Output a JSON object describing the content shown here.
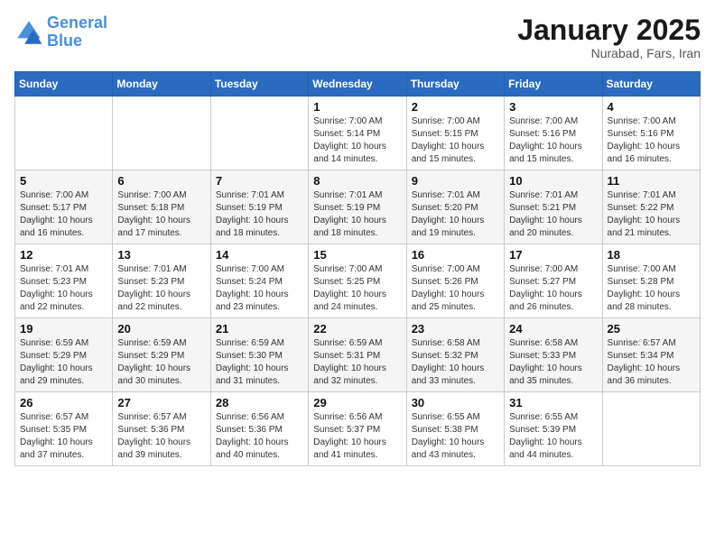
{
  "header": {
    "logo_line1": "General",
    "logo_line2": "Blue",
    "month": "January 2025",
    "location": "Nurabad, Fars, Iran"
  },
  "weekdays": [
    "Sunday",
    "Monday",
    "Tuesday",
    "Wednesday",
    "Thursday",
    "Friday",
    "Saturday"
  ],
  "weeks": [
    [
      {
        "day": "",
        "info": ""
      },
      {
        "day": "",
        "info": ""
      },
      {
        "day": "",
        "info": ""
      },
      {
        "day": "1",
        "info": "Sunrise: 7:00 AM\nSunset: 5:14 PM\nDaylight: 10 hours\nand 14 minutes."
      },
      {
        "day": "2",
        "info": "Sunrise: 7:00 AM\nSunset: 5:15 PM\nDaylight: 10 hours\nand 15 minutes."
      },
      {
        "day": "3",
        "info": "Sunrise: 7:00 AM\nSunset: 5:16 PM\nDaylight: 10 hours\nand 15 minutes."
      },
      {
        "day": "4",
        "info": "Sunrise: 7:00 AM\nSunset: 5:16 PM\nDaylight: 10 hours\nand 16 minutes."
      }
    ],
    [
      {
        "day": "5",
        "info": "Sunrise: 7:00 AM\nSunset: 5:17 PM\nDaylight: 10 hours\nand 16 minutes."
      },
      {
        "day": "6",
        "info": "Sunrise: 7:00 AM\nSunset: 5:18 PM\nDaylight: 10 hours\nand 17 minutes."
      },
      {
        "day": "7",
        "info": "Sunrise: 7:01 AM\nSunset: 5:19 PM\nDaylight: 10 hours\nand 18 minutes."
      },
      {
        "day": "8",
        "info": "Sunrise: 7:01 AM\nSunset: 5:19 PM\nDaylight: 10 hours\nand 18 minutes."
      },
      {
        "day": "9",
        "info": "Sunrise: 7:01 AM\nSunset: 5:20 PM\nDaylight: 10 hours\nand 19 minutes."
      },
      {
        "day": "10",
        "info": "Sunrise: 7:01 AM\nSunset: 5:21 PM\nDaylight: 10 hours\nand 20 minutes."
      },
      {
        "day": "11",
        "info": "Sunrise: 7:01 AM\nSunset: 5:22 PM\nDaylight: 10 hours\nand 21 minutes."
      }
    ],
    [
      {
        "day": "12",
        "info": "Sunrise: 7:01 AM\nSunset: 5:23 PM\nDaylight: 10 hours\nand 22 minutes."
      },
      {
        "day": "13",
        "info": "Sunrise: 7:01 AM\nSunset: 5:23 PM\nDaylight: 10 hours\nand 22 minutes."
      },
      {
        "day": "14",
        "info": "Sunrise: 7:00 AM\nSunset: 5:24 PM\nDaylight: 10 hours\nand 23 minutes."
      },
      {
        "day": "15",
        "info": "Sunrise: 7:00 AM\nSunset: 5:25 PM\nDaylight: 10 hours\nand 24 minutes."
      },
      {
        "day": "16",
        "info": "Sunrise: 7:00 AM\nSunset: 5:26 PM\nDaylight: 10 hours\nand 25 minutes."
      },
      {
        "day": "17",
        "info": "Sunrise: 7:00 AM\nSunset: 5:27 PM\nDaylight: 10 hours\nand 26 minutes."
      },
      {
        "day": "18",
        "info": "Sunrise: 7:00 AM\nSunset: 5:28 PM\nDaylight: 10 hours\nand 28 minutes."
      }
    ],
    [
      {
        "day": "19",
        "info": "Sunrise: 6:59 AM\nSunset: 5:29 PM\nDaylight: 10 hours\nand 29 minutes."
      },
      {
        "day": "20",
        "info": "Sunrise: 6:59 AM\nSunset: 5:29 PM\nDaylight: 10 hours\nand 30 minutes."
      },
      {
        "day": "21",
        "info": "Sunrise: 6:59 AM\nSunset: 5:30 PM\nDaylight: 10 hours\nand 31 minutes."
      },
      {
        "day": "22",
        "info": "Sunrise: 6:59 AM\nSunset: 5:31 PM\nDaylight: 10 hours\nand 32 minutes."
      },
      {
        "day": "23",
        "info": "Sunrise: 6:58 AM\nSunset: 5:32 PM\nDaylight: 10 hours\nand 33 minutes."
      },
      {
        "day": "24",
        "info": "Sunrise: 6:58 AM\nSunset: 5:33 PM\nDaylight: 10 hours\nand 35 minutes."
      },
      {
        "day": "25",
        "info": "Sunrise: 6:57 AM\nSunset: 5:34 PM\nDaylight: 10 hours\nand 36 minutes."
      }
    ],
    [
      {
        "day": "26",
        "info": "Sunrise: 6:57 AM\nSunset: 5:35 PM\nDaylight: 10 hours\nand 37 minutes."
      },
      {
        "day": "27",
        "info": "Sunrise: 6:57 AM\nSunset: 5:36 PM\nDaylight: 10 hours\nand 39 minutes."
      },
      {
        "day": "28",
        "info": "Sunrise: 6:56 AM\nSunset: 5:36 PM\nDaylight: 10 hours\nand 40 minutes."
      },
      {
        "day": "29",
        "info": "Sunrise: 6:56 AM\nSunset: 5:37 PM\nDaylight: 10 hours\nand 41 minutes."
      },
      {
        "day": "30",
        "info": "Sunrise: 6:55 AM\nSunset: 5:38 PM\nDaylight: 10 hours\nand 43 minutes."
      },
      {
        "day": "31",
        "info": "Sunrise: 6:55 AM\nSunset: 5:39 PM\nDaylight: 10 hours\nand 44 minutes."
      },
      {
        "day": "",
        "info": ""
      }
    ]
  ]
}
